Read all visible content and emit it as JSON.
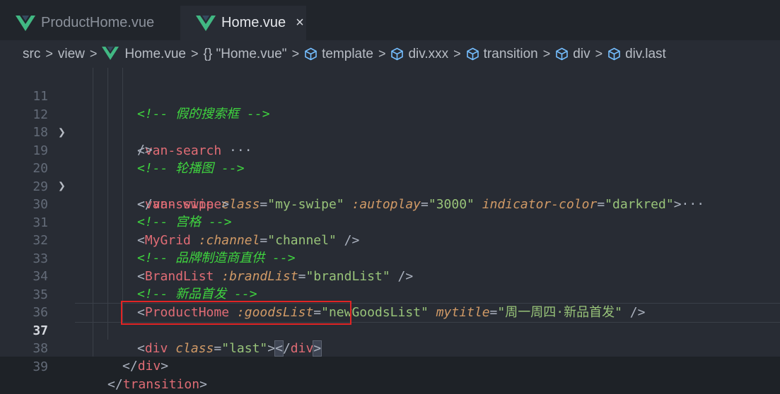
{
  "tabs": [
    {
      "label": "ProductHome.vue",
      "active": false
    },
    {
      "label": "Home.vue",
      "active": true,
      "close_icon": "×"
    }
  ],
  "breadcrumb": {
    "items": [
      "src",
      "view",
      "Home.vue",
      "{} \"Home.vue\"",
      "template",
      "div.xxx",
      "transition",
      "div",
      "div.last"
    ],
    "separator": ">"
  },
  "colors": {
    "vue_green": "#41b883",
    "vue_dark": "#35495e",
    "symbol_blue": "#75beff",
    "highlight_box": "#e12424"
  },
  "icons": [
    "vue-file-icon",
    "curly-braces-icon",
    "cube-icon",
    "chevron-right-icon",
    "close-icon"
  ],
  "editor": {
    "current_line": "37",
    "lines": [
      {
        "num": "11",
        "text": "<!-- 假的搜索框 -->"
      },
      {
        "num": "12",
        "text": "<van-search ···",
        "folded": true
      },
      {
        "num": "18",
        "text": "/>"
      },
      {
        "num": "19",
        "text": "<!-- 轮播图 -->"
      },
      {
        "num": "20",
        "text": "<van-swipe class=\"my-swipe\" :autoplay=\"3000\" indicator-color=\"darkred\">···",
        "folded": true
      },
      {
        "num": "29",
        "text": "</van-swipe>"
      },
      {
        "num": "30",
        "text": "<!-- 宫格 -->"
      },
      {
        "num": "31",
        "text": "<MyGrid :channel=\"channel\" />"
      },
      {
        "num": "32",
        "text": "<!-- 品牌制造商直供 -->"
      },
      {
        "num": "33",
        "text": "<BrandList :brandList=\"brandList\" />"
      },
      {
        "num": "34",
        "text": "<!-- 新品首发 -->"
      },
      {
        "num": "35",
        "text": "<ProductHome :goodsList=\"newGoodsList\" mytitle=\"周一周四·新品首发\" />"
      },
      {
        "num": "36",
        "text": ""
      },
      {
        "num": "37",
        "text": "<div class=\"last\"></div>"
      },
      {
        "num": "38",
        "text": "</div>"
      },
      {
        "num": "39",
        "text": "</transition>"
      }
    ]
  }
}
